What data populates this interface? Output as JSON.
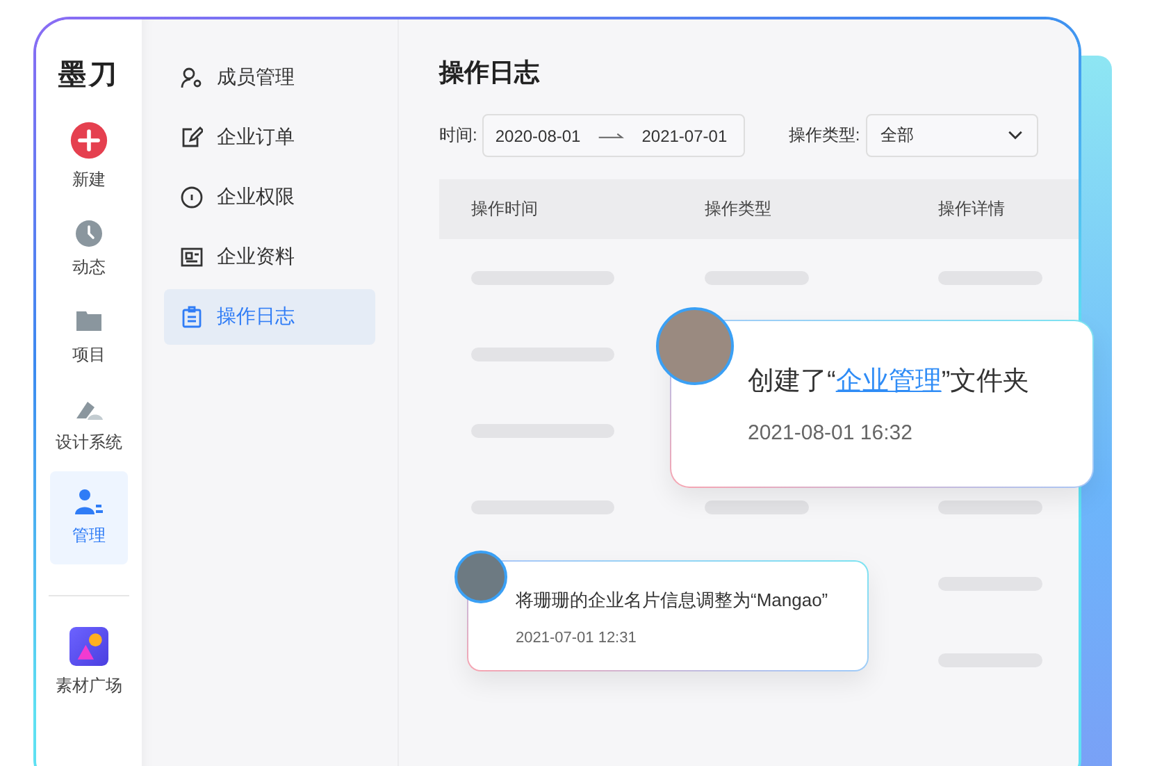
{
  "logo": "墨刀",
  "rail": [
    {
      "label": "新建",
      "selected": false
    },
    {
      "label": "动态",
      "selected": false
    },
    {
      "label": "项目",
      "selected": false
    },
    {
      "label": "设计系统",
      "selected": false
    },
    {
      "label": "管理",
      "selected": true
    }
  ],
  "rail_bottom": {
    "label": "素材广场"
  },
  "submenu": [
    {
      "label": "成员管理",
      "selected": false
    },
    {
      "label": "企业订单",
      "selected": false
    },
    {
      "label": "企业权限",
      "selected": false
    },
    {
      "label": "企业资料",
      "selected": false
    },
    {
      "label": "操作日志",
      "selected": true
    }
  ],
  "title": "操作日志",
  "filters": {
    "time_label": "时间:",
    "start": "2020-08-01",
    "end": "2021-07-01",
    "type_label": "操作类型:",
    "type_value": "全部"
  },
  "table": {
    "columns": [
      "操作时间",
      "操作类型",
      "操作详情"
    ]
  },
  "notifications": [
    {
      "before": "创建了“",
      "link": "企业管理",
      "after": "”文件夹",
      "time": "2021-08-01 16:32"
    },
    {
      "before": "将珊珊的企业名片信息调整为“Mangao”",
      "time": "2021-07-01 12:31"
    }
  ]
}
